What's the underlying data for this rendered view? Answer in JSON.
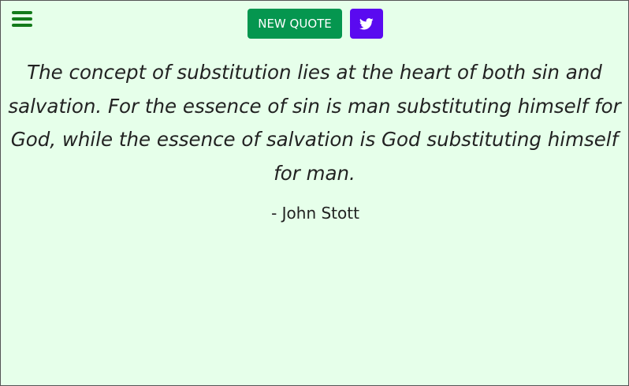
{
  "menu": {
    "icon": "hamburger-menu-icon"
  },
  "controls": {
    "new_quote_label": "NEW QUOTE",
    "tweet_icon": "twitter-bird-icon"
  },
  "quote": {
    "text": "The concept of substitution lies at the heart of both sin and salvation. For the essence of sin is man substituting himself for God, while the essence of salvation is God substituting himself for man.",
    "author": "- John Stott"
  },
  "colors": {
    "background": "#e6ffea",
    "menu_icon": "#137a1b",
    "new_quote_button": "#05964f",
    "tweet_button": "#5a0af0",
    "text": "#222222"
  }
}
